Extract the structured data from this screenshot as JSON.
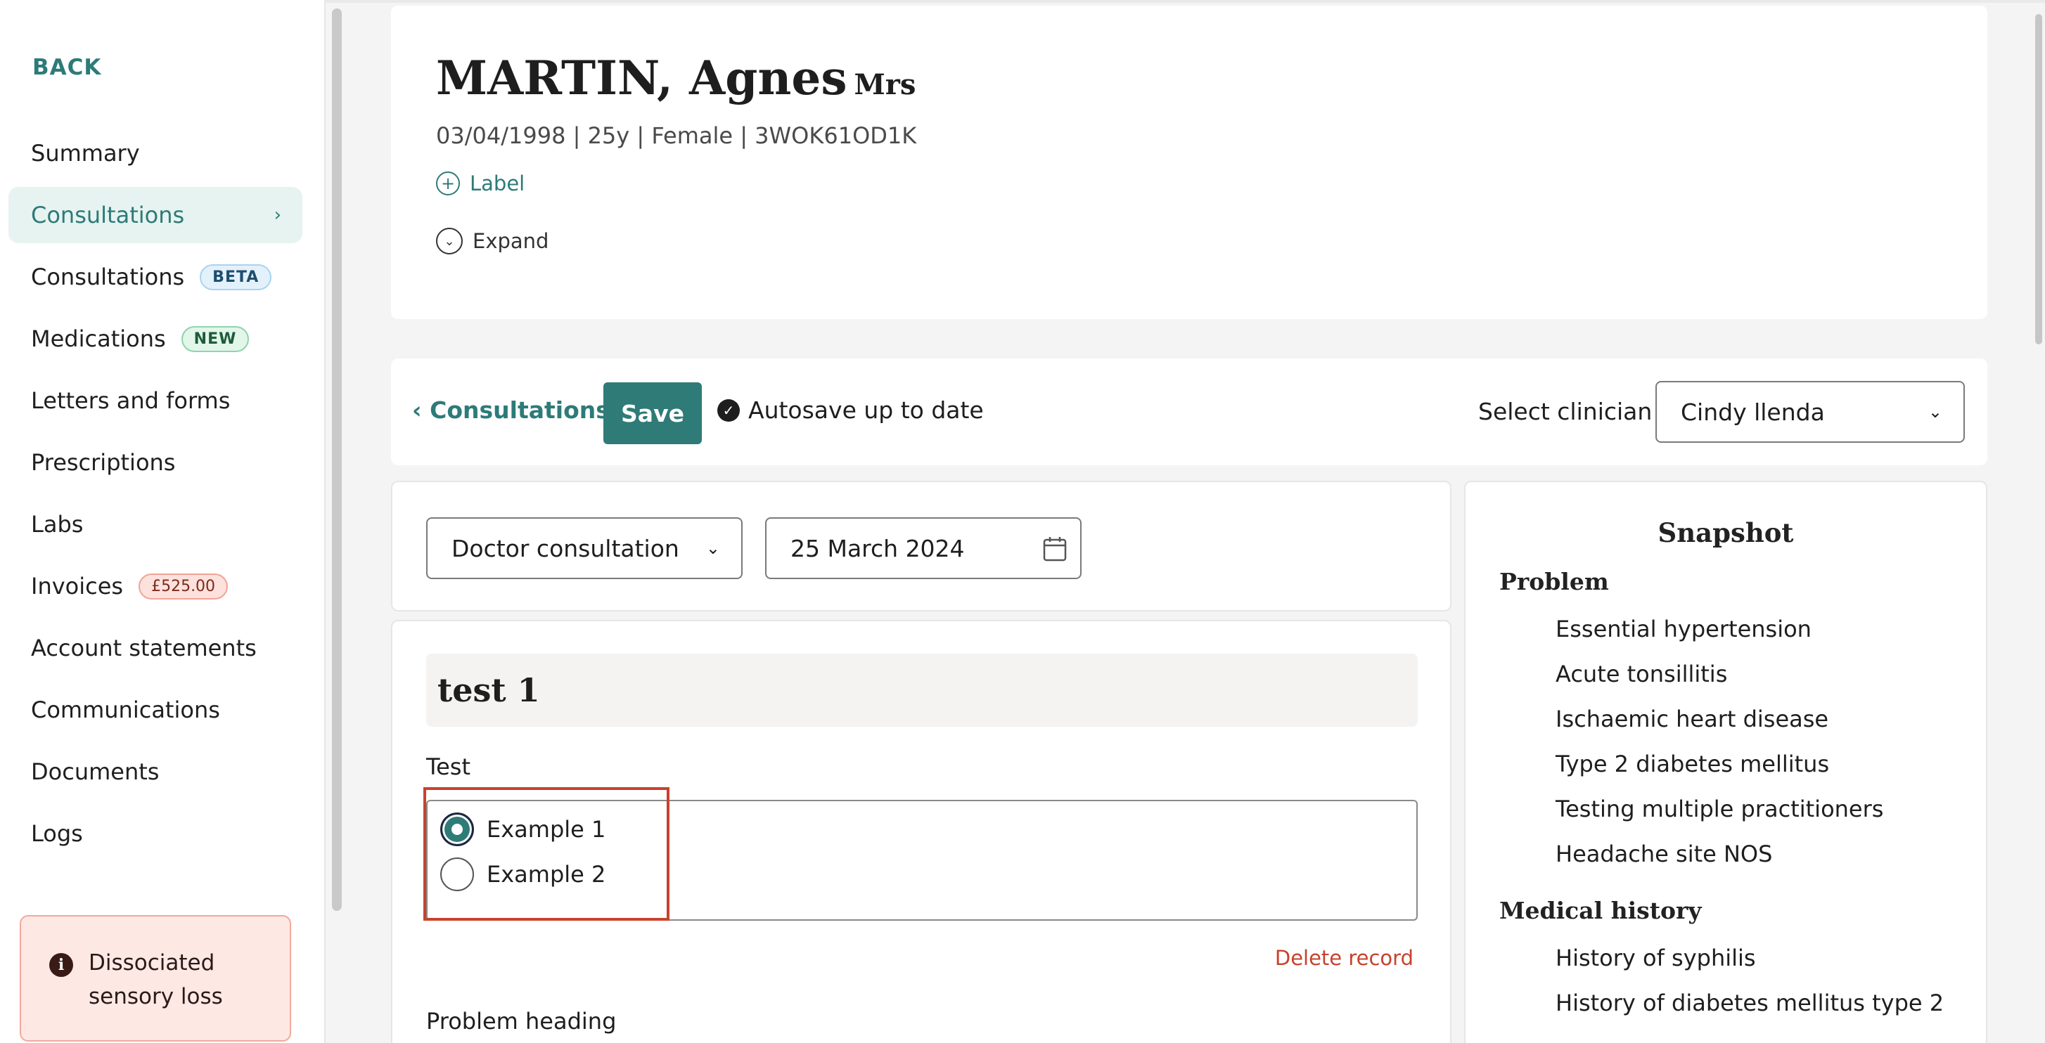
{
  "sidebar": {
    "back_label": "BACK",
    "items": [
      {
        "label": "Summary"
      },
      {
        "label": "Consultations",
        "active": true
      },
      {
        "label": "Consultations",
        "badge": "BETA"
      },
      {
        "label": "Medications",
        "badge": "NEW"
      },
      {
        "label": "Letters and forms"
      },
      {
        "label": "Prescriptions"
      },
      {
        "label": "Labs"
      },
      {
        "label": "Invoices",
        "badge": "£525.00"
      },
      {
        "label": "Account statements"
      },
      {
        "label": "Communications"
      },
      {
        "label": "Documents"
      },
      {
        "label": "Logs"
      }
    ],
    "alert": {
      "icon": "info-icon",
      "text": "Dissociated sensory loss"
    }
  },
  "patient": {
    "name": "MARTIN, Agnes",
    "title": "Mrs",
    "meta": "03/04/1998  |  25y  |  Female  |  3WOK61OD1K",
    "label_link": "Label",
    "expand_link": "Expand"
  },
  "toolbar": {
    "back_label": "Consultations",
    "save_label": "Save",
    "autosave_text": "Autosave up to date",
    "clinician_label": "Select clinician",
    "clinician_value": "Cindy llenda"
  },
  "consultation": {
    "type_value": "Doctor consultation",
    "date_value": "25 March 2024"
  },
  "record": {
    "title": "test 1",
    "field_label": "Test",
    "options": [
      {
        "label": "Example 1",
        "selected": true
      },
      {
        "label": "Example 2",
        "selected": false
      }
    ],
    "delete_label": "Delete record",
    "next_heading": "Problem heading"
  },
  "snapshot": {
    "title": "Snapshot",
    "problem_heading": "Problem",
    "problems": [
      "Essential hypertension",
      "Acute tonsillitis",
      "Ischaemic heart disease",
      "Type 2 diabetes mellitus",
      "Testing multiple practitioners",
      "Headache site NOS"
    ],
    "history_heading": "Medical history",
    "history": [
      "History of syphilis",
      "History of diabetes mellitus type 2"
    ]
  },
  "colors": {
    "accent": "#2d7b78",
    "danger": "#c8422c",
    "active_bg": "#e7f3f0"
  }
}
